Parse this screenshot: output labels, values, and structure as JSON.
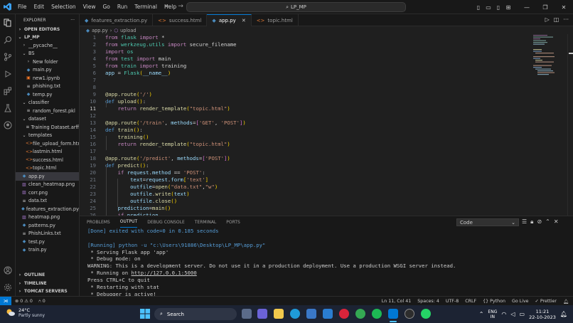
{
  "titlebar": {
    "menu": [
      "File",
      "Edit",
      "Selection",
      "View",
      "Go",
      "Run",
      "Terminal",
      "Help"
    ],
    "search": "LP_MP",
    "nav_back": "←",
    "nav_forward": "→"
  },
  "explorer": {
    "header": "EXPLORER",
    "more": "···",
    "open_editors": "OPEN EDITORS",
    "root": "LP_MP",
    "items": [
      {
        "label": "__pycache__",
        "indent": 1,
        "icon": "chevron-right",
        "color": "#cccccc"
      },
      {
        "label": "BS",
        "indent": 1,
        "icon": "chevron-down",
        "color": "#cccccc"
      },
      {
        "label": "New folder",
        "indent": 2,
        "icon": "chevron-right",
        "color": "#cccccc"
      },
      {
        "label": "main.py",
        "indent": 2,
        "icon": "python",
        "color": "#4b8bbe"
      },
      {
        "label": "new1.ipynb",
        "indent": 2,
        "icon": "notebook",
        "color": "#f37626"
      },
      {
        "label": "phishing.txt",
        "indent": 2,
        "icon": "text",
        "color": "#cccccc"
      },
      {
        "label": "temp.py",
        "indent": 2,
        "icon": "python",
        "color": "#4b8bbe"
      },
      {
        "label": "classifier",
        "indent": 1,
        "icon": "chevron-down",
        "color": "#cccccc"
      },
      {
        "label": "random_forest.pkl",
        "indent": 2,
        "icon": "text",
        "color": "#cccccc"
      },
      {
        "label": "dataset",
        "indent": 1,
        "icon": "chevron-down",
        "color": "#cccccc"
      },
      {
        "label": "Training Dataset.arff",
        "indent": 2,
        "icon": "text",
        "color": "#cccccc"
      },
      {
        "label": "templates",
        "indent": 1,
        "icon": "chevron-down",
        "color": "#cccccc"
      },
      {
        "label": "file_upload_form.html",
        "indent": 2,
        "icon": "html",
        "color": "#e37933"
      },
      {
        "label": "lastmin.html",
        "indent": 2,
        "icon": "html",
        "color": "#e37933"
      },
      {
        "label": "success.html",
        "indent": 2,
        "icon": "html",
        "color": "#e37933"
      },
      {
        "label": "topic.html",
        "indent": 2,
        "icon": "html",
        "color": "#e37933"
      },
      {
        "label": "app.py",
        "indent": 1,
        "icon": "python",
        "color": "#4b8bbe",
        "selected": true
      },
      {
        "label": "clean_heatmap.png",
        "indent": 1,
        "icon": "image",
        "color": "#a074c4"
      },
      {
        "label": "corr.png",
        "indent": 1,
        "icon": "image",
        "color": "#a074c4"
      },
      {
        "label": "data.txt",
        "indent": 1,
        "icon": "text",
        "color": "#cccccc"
      },
      {
        "label": "features_extraction.py",
        "indent": 1,
        "icon": "python",
        "color": "#4b8bbe"
      },
      {
        "label": "heatmap.png",
        "indent": 1,
        "icon": "image",
        "color": "#a074c4"
      },
      {
        "label": "patterns.py",
        "indent": 1,
        "icon": "python",
        "color": "#4b8bbe"
      },
      {
        "label": "PhishLinks.txt",
        "indent": 1,
        "icon": "text",
        "color": "#cccccc"
      },
      {
        "label": "test.py",
        "indent": 1,
        "icon": "python",
        "color": "#4b8bbe"
      },
      {
        "label": "train.py",
        "indent": 1,
        "icon": "python",
        "color": "#4b8bbe"
      }
    ],
    "bottom_sections": [
      "OUTLINE",
      "TIMELINE",
      "TOMCAT SERVERS"
    ]
  },
  "tabs": [
    {
      "label": "features_extraction.py",
      "icon": "python",
      "active": false
    },
    {
      "label": "success.html",
      "icon": "html",
      "active": false
    },
    {
      "label": "app.py",
      "icon": "python",
      "active": true
    },
    {
      "label": "topic.html",
      "icon": "html",
      "active": false
    }
  ],
  "tab_close": "✕",
  "breadcrumb": {
    "file": "app.py",
    "sep": "›",
    "symbol": "upload"
  },
  "editor": {
    "current_line": 11,
    "lines": [
      [
        [
          "kw",
          "from "
        ],
        [
          "cls",
          "flask "
        ],
        [
          "kw",
          "import "
        ],
        [
          "txt",
          "*"
        ]
      ],
      [
        [
          "kw",
          "from "
        ],
        [
          "cls",
          "werkzeug.utils "
        ],
        [
          "kw",
          "import "
        ],
        [
          "txt",
          "secure_filename"
        ]
      ],
      [
        [
          "kw",
          "import "
        ],
        [
          "cls",
          "os"
        ]
      ],
      [
        [
          "kw",
          "from "
        ],
        [
          "cls",
          "test "
        ],
        [
          "kw",
          "import "
        ],
        [
          "txt",
          "main"
        ]
      ],
      [
        [
          "kw",
          "from "
        ],
        [
          "cls",
          "train "
        ],
        [
          "kw",
          "import "
        ],
        [
          "txt",
          "training"
        ]
      ],
      [
        [
          "var",
          "app "
        ],
        [
          "txt",
          "= "
        ],
        [
          "cls",
          "Flask"
        ],
        [
          "br1",
          "("
        ],
        [
          "var",
          "__name__"
        ],
        [
          "br1",
          ")"
        ]
      ],
      [],
      [],
      [
        [
          "fn",
          "@app.route"
        ],
        [
          "br1",
          "("
        ],
        [
          "str",
          "'/'"
        ],
        [
          "br1",
          ")"
        ]
      ],
      [
        [
          "kd",
          "def "
        ],
        [
          "fn",
          "upload"
        ],
        [
          "br1",
          "()"
        ],
        [
          "txt",
          ":"
        ]
      ],
      [
        [
          "txt",
          "    "
        ],
        [
          "kw",
          "return "
        ],
        [
          "fn",
          "render_template"
        ],
        [
          "br1",
          "("
        ],
        [
          "str",
          "\"topic.html\""
        ],
        [
          "br1",
          ")"
        ]
      ],
      [],
      [
        [
          "fn",
          "@app.route"
        ],
        [
          "br1",
          "("
        ],
        [
          "str",
          "'/train'"
        ],
        [
          "txt",
          ", "
        ],
        [
          "var",
          "methods"
        ],
        [
          "txt",
          "="
        ],
        [
          "br2",
          "["
        ],
        [
          "str",
          "'GET'"
        ],
        [
          "txt",
          ", "
        ],
        [
          "str",
          "'POST'"
        ],
        [
          "br2",
          "]"
        ],
        [
          "br1",
          ")"
        ]
      ],
      [
        [
          "kd",
          "def "
        ],
        [
          "fn",
          "train"
        ],
        [
          "br1",
          "()"
        ],
        [
          "txt",
          ":"
        ]
      ],
      [
        [
          "txt",
          "    "
        ],
        [
          "fn",
          "training"
        ],
        [
          "br1",
          "()"
        ]
      ],
      [
        [
          "txt",
          "    "
        ],
        [
          "kw",
          "return "
        ],
        [
          "fn",
          "render_template"
        ],
        [
          "br1",
          "("
        ],
        [
          "str",
          "\"topic.html\""
        ],
        [
          "br1",
          ")"
        ]
      ],
      [],
      [
        [
          "fn",
          "@app.route"
        ],
        [
          "br1",
          "("
        ],
        [
          "str",
          "'/predict'"
        ],
        [
          "txt",
          ", "
        ],
        [
          "var",
          "methods"
        ],
        [
          "txt",
          "="
        ],
        [
          "br2",
          "["
        ],
        [
          "str",
          "'POST'"
        ],
        [
          "br2",
          "]"
        ],
        [
          "br1",
          ")"
        ]
      ],
      [
        [
          "kd",
          "def "
        ],
        [
          "fn",
          "predict"
        ],
        [
          "br1",
          "()"
        ],
        [
          "txt",
          ":"
        ]
      ],
      [
        [
          "txt",
          "    "
        ],
        [
          "kw",
          "if "
        ],
        [
          "var",
          "request"
        ],
        [
          "txt",
          "."
        ],
        [
          "var",
          "method "
        ],
        [
          "txt",
          "== "
        ],
        [
          "str",
          "'POST'"
        ],
        [
          "txt",
          ":"
        ]
      ],
      [
        [
          "txt",
          "        "
        ],
        [
          "var",
          "text"
        ],
        [
          "txt",
          "="
        ],
        [
          "var",
          "request"
        ],
        [
          "txt",
          "."
        ],
        [
          "var",
          "form"
        ],
        [
          "br1",
          "["
        ],
        [
          "str",
          "'text'"
        ],
        [
          "br1",
          "]"
        ]
      ],
      [
        [
          "txt",
          "        "
        ],
        [
          "var",
          "outfile"
        ],
        [
          "txt",
          "="
        ],
        [
          "fn",
          "open"
        ],
        [
          "br1",
          "("
        ],
        [
          "str",
          "\"data.txt\""
        ],
        [
          "txt",
          ","
        ],
        [
          "str",
          "\"w\""
        ],
        [
          "br1",
          ")"
        ]
      ],
      [
        [
          "txt",
          "        "
        ],
        [
          "var",
          "outfile"
        ],
        [
          "txt",
          "."
        ],
        [
          "fn",
          "write"
        ],
        [
          "br1",
          "("
        ],
        [
          "var",
          "text"
        ],
        [
          "br1",
          ")"
        ]
      ],
      [
        [
          "txt",
          "        "
        ],
        [
          "var",
          "outfile"
        ],
        [
          "txt",
          "."
        ],
        [
          "fn",
          "close"
        ],
        [
          "br1",
          "()"
        ]
      ],
      [
        [
          "txt",
          "    "
        ],
        [
          "var",
          "prediction"
        ],
        [
          "txt",
          "="
        ],
        [
          "fn",
          "main"
        ],
        [
          "br1",
          "()"
        ]
      ],
      [
        [
          "txt",
          "    "
        ],
        [
          "kw",
          "if "
        ],
        [
          "var",
          "prediction"
        ],
        [
          "txt",
          "..."
        ]
      ]
    ]
  },
  "panel": {
    "tabs": [
      "PROBLEMS",
      "OUTPUT",
      "DEBUG CONSOLE",
      "TERMINAL",
      "PORTS"
    ],
    "active_tab": "OUTPUT",
    "dropdown": "Code",
    "output": [
      {
        "text": "[Done] exited with code=0 in 0.185 seconds",
        "style": "done"
      },
      {
        "text": "",
        "style": ""
      },
      {
        "text": "[Running] python -u \"c:\\Users\\91886\\Desktop\\LP_MP\\app.py\"",
        "style": "blue"
      },
      {
        "text": " * Serving Flask app 'app'",
        "style": ""
      },
      {
        "text": " * Debug mode: on",
        "style": ""
      },
      {
        "text": "WARNING: This is a development server. Do not use it in a production deployment. Use a production WSGI server instead.",
        "style": ""
      },
      {
        "text": " * Running on ",
        "style": "",
        "link": "http://127.0.0.1:5000"
      },
      {
        "text": "Press CTRL+C to quit",
        "style": ""
      },
      {
        "text": " * Restarting with stat",
        "style": ""
      },
      {
        "text": " * Debugger is active!",
        "style": ""
      }
    ]
  },
  "statusbar": {
    "errors": "⊗ 0 ⚠ 0",
    "ports": "⑃ 0",
    "right": [
      "Ln 11, Col 41",
      "Spaces: 4",
      "UTF-8",
      "CRLF",
      "{} Python",
      "Go Live",
      "✓ Prettier"
    ]
  },
  "taskbar": {
    "temp": "24°C",
    "weather": "Partly sunny",
    "search": "Search",
    "lang1": "ENG",
    "lang2": "IN",
    "time": "11:21",
    "date": "22-10-2023"
  },
  "colors": {
    "accent": "#0078d4"
  }
}
